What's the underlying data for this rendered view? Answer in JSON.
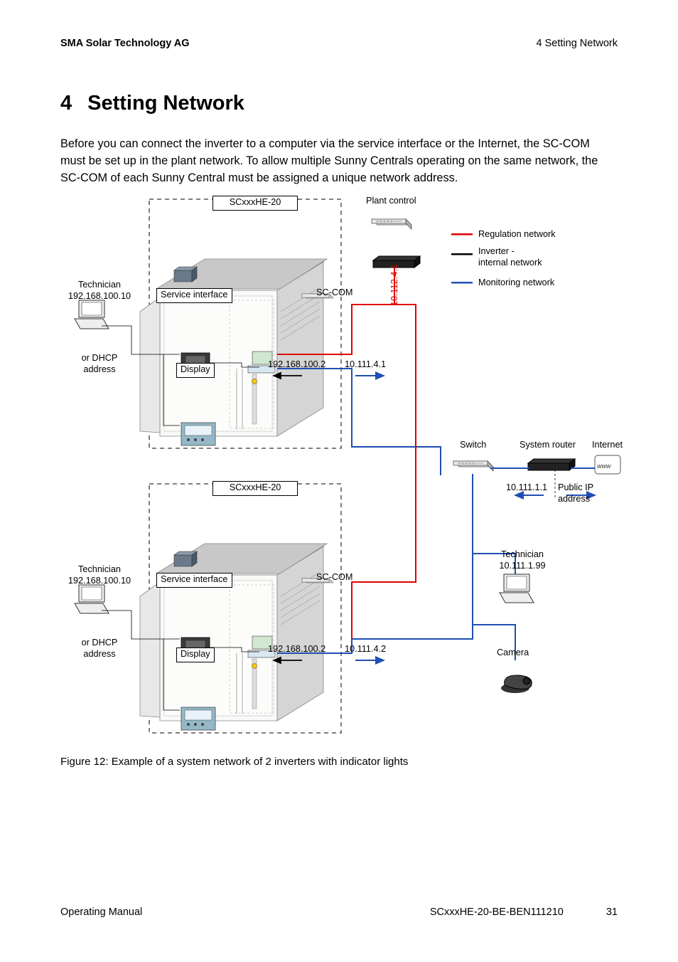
{
  "header": {
    "left": "SMA Solar Technology AG",
    "right": "4  Setting Network"
  },
  "heading": {
    "num": "4",
    "title": "Setting Network"
  },
  "body_paragraph": "Before you can connect the inverter to a computer via the service interface or the Internet, the SC-COM must be set up in the plant network. To allow multiple Sunny Centrals operating on the same network, the SC-COM of each Sunny Central must be assigned a unique network address.",
  "figure": {
    "caption": "Figure 12:  Example of a system network of 2 inverters with indicator lights",
    "labels": {
      "plant_control": "Plant control",
      "legend": {
        "regulation": "Regulation network",
        "inverter_internal": "Inverter -\ninternal network",
        "monitoring": "Monitoring network"
      },
      "inverter_model": "SCxxxHE-20",
      "service_interface": "Service interface",
      "display": "Display",
      "sc_com": "SC-COM",
      "regulation_ip": "10.112.4.1",
      "technician_local": "Technician\n192.168.100.10",
      "dhcp": "or DHCP\naddress",
      "sc_com_ip_local": "192.168.100.2",
      "sc_com_ip_net_1": "10.111.4.1",
      "sc_com_ip_net_2": "10.111.4.2",
      "switch": "Switch",
      "system_router": "System router",
      "internet": "Internet",
      "router_ip": "10.111.1.1",
      "public_ip": "Public IP address",
      "technician_remote": "Technician\n10.111.1.99",
      "camera": "Camera"
    }
  },
  "footer": {
    "left": "Operating Manual",
    "center": "SCxxxHE-20-BE-BEN111210",
    "page": "31"
  },
  "colors": {
    "regulation": "#e00000",
    "inverter_internal": "#000000",
    "monitoring": "#1e4fb3"
  }
}
